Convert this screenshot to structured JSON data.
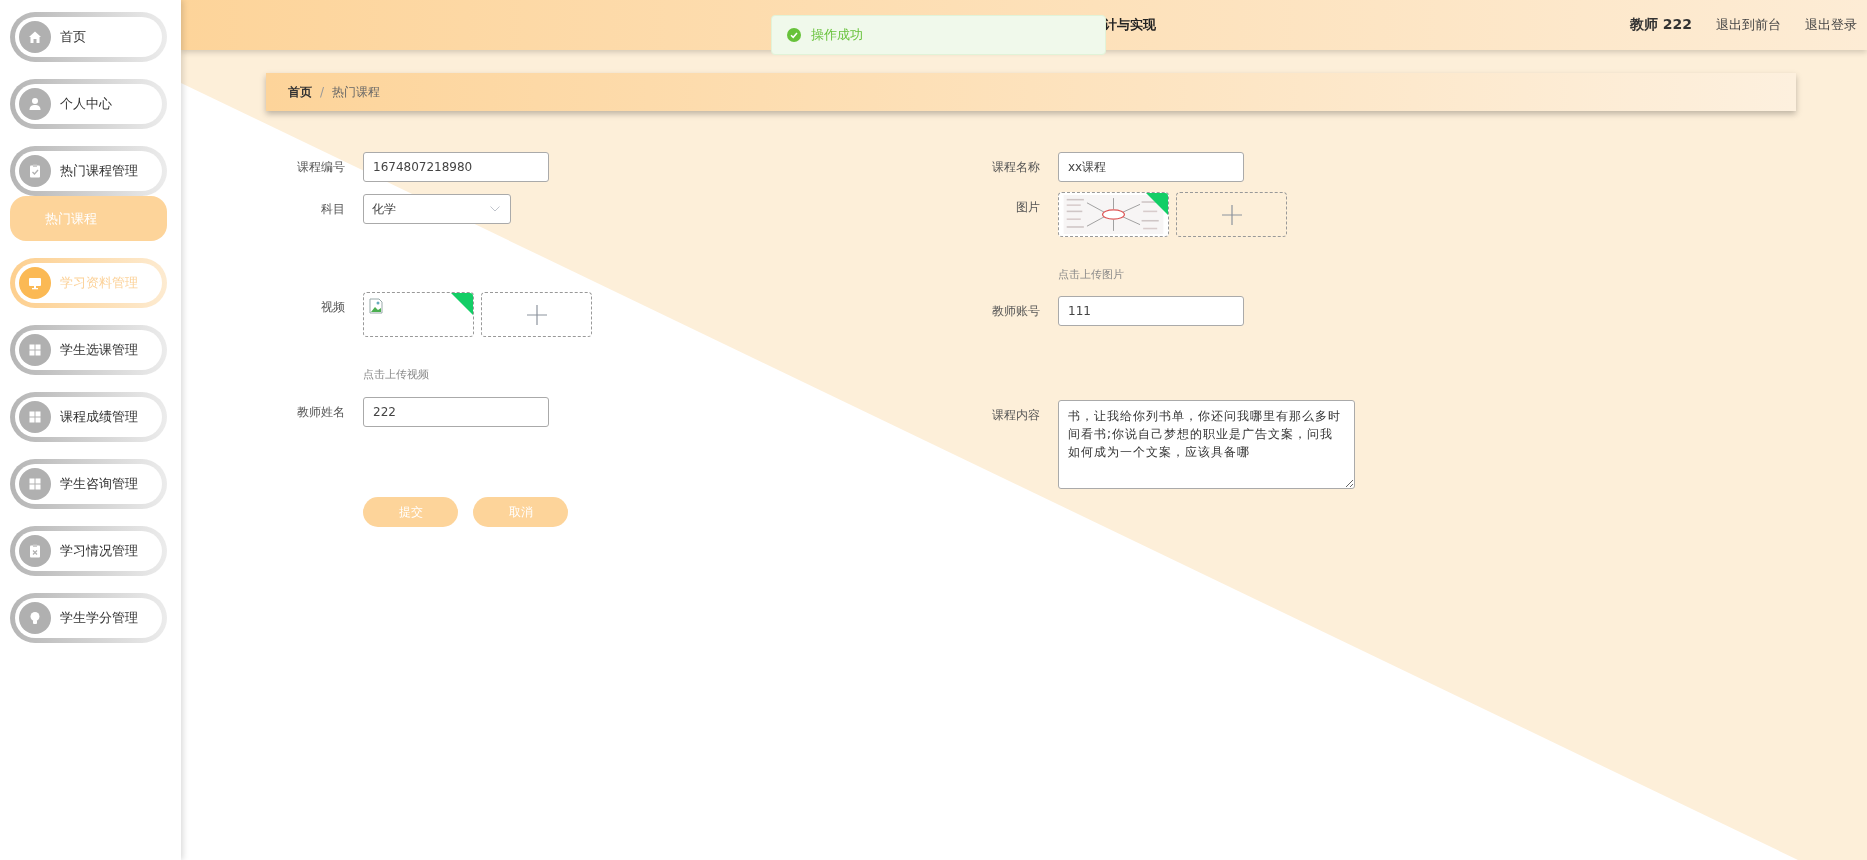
{
  "sidebar": {
    "items": [
      {
        "label": "首页",
        "kind": "home",
        "hovered": false
      },
      {
        "label": "个人中心",
        "kind": "user",
        "hovered": false
      },
      {
        "label": "热门课程管理",
        "kind": "clipboard-check",
        "hovered": false,
        "expanded": true,
        "children": [
          {
            "label": "热门课程",
            "selected": true
          }
        ]
      },
      {
        "label": "学习资料管理",
        "kind": "monitor",
        "hovered": true
      },
      {
        "label": "学生选课管理",
        "kind": "grid",
        "hovered": false
      },
      {
        "label": "课程成绩管理",
        "kind": "grid",
        "hovered": false
      },
      {
        "label": "学生咨询管理",
        "kind": "grid",
        "hovered": false
      },
      {
        "label": "学习情况管理",
        "kind": "clipboard-x",
        "hovered": false
      },
      {
        "label": "学生学分管理",
        "kind": "bulb",
        "hovered": false
      }
    ]
  },
  "header": {
    "title": "计与实现",
    "user": "教师 222",
    "links": [
      "退出到前台",
      "退出登录"
    ]
  },
  "toast": {
    "message": "操作成功"
  },
  "breadcrumb": {
    "items": [
      "首页",
      "热门课程"
    ],
    "separator": "/"
  },
  "form": {
    "left": [
      {
        "label": "课程编号",
        "kind": "text",
        "value": "1674807218980"
      },
      {
        "label": "科目",
        "kind": "select",
        "value": "化学"
      },
      {
        "label": "视频",
        "kind": "upload",
        "files": [
          {
            "kind": "broken"
          }
        ],
        "hint": "点击上传视频"
      },
      {
        "label": "教师姓名",
        "kind": "text",
        "value": "222"
      }
    ],
    "right": [
      {
        "label": "课程名称",
        "kind": "text",
        "value": "xx课程"
      },
      {
        "label": "图片",
        "kind": "upload",
        "hint": "点击上传图片"
      },
      {
        "label": "教师账号",
        "kind": "text",
        "value": "111"
      },
      {
        "label": "课程内容",
        "kind": "textarea",
        "value": "书，让我给你列书单，你还问我哪里有那么多时间看书;你说自己梦想的职业是广告文案，问我如何成为一个文案，应该具备哪"
      }
    ],
    "buttons": [
      "提交",
      "取消"
    ]
  }
}
